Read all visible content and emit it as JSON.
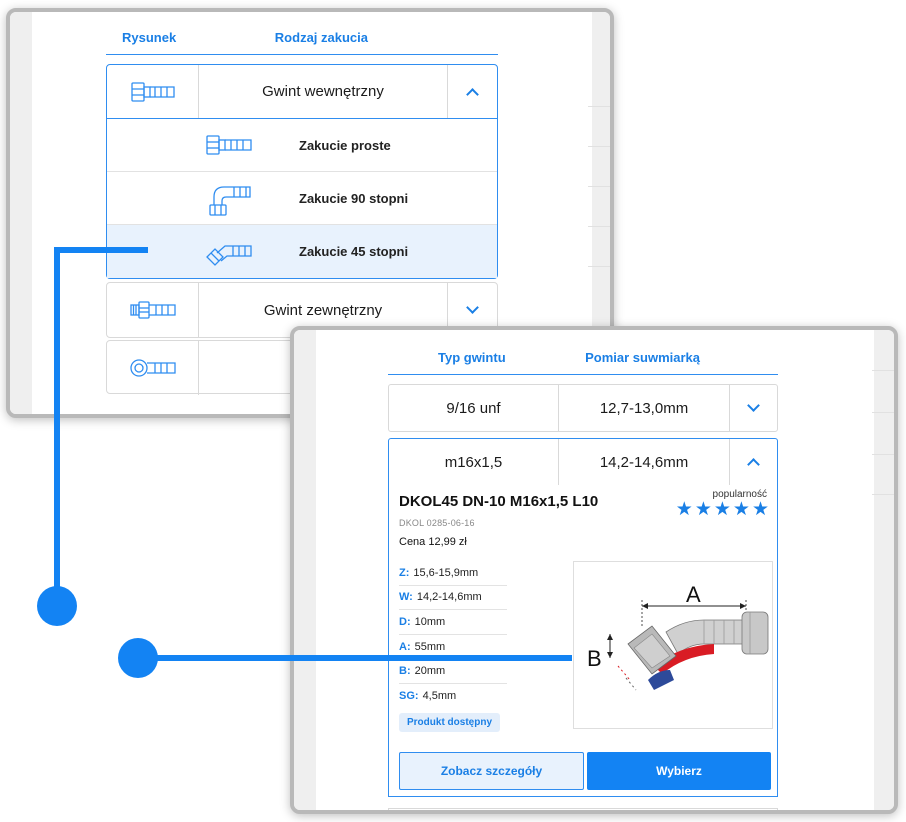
{
  "window1": {
    "tabs": [
      "Rysunek",
      "Rodzaj zakucia"
    ],
    "groups": [
      {
        "label": "Gwint wewnętrzny",
        "icon": "fitting-internal-thread-icon",
        "expanded": true,
        "items": [
          {
            "label": "Zakucie proste",
            "icon": "straight-fitting-icon"
          },
          {
            "label": "Zakucie 90 stopni",
            "icon": "elbow-90-fitting-icon"
          },
          {
            "label": "Zakucie 45 stopni",
            "icon": "elbow-45-fitting-icon",
            "selected": true
          }
        ]
      },
      {
        "label": "Gwint zewnętrzny",
        "icon": "fitting-external-thread-icon",
        "expanded": false
      },
      {
        "label": "",
        "icon": "banjo-fitting-icon",
        "expanded": false
      }
    ]
  },
  "window2": {
    "tabs": [
      "Typ gwintu",
      "Pomiar suwmiarką"
    ],
    "rows": [
      {
        "thread": "9/16 unf",
        "measure": "12,7-13,0mm",
        "expanded": false
      },
      {
        "thread": "m16x1,5",
        "measure": "14,2-14,6mm",
        "expanded": true
      }
    ],
    "product": {
      "title": "DKOL45 DN-10 M16x1,5 L10",
      "code": "DKOL 0285-06-16",
      "price": "Cena 12,99 zł",
      "popularity_label": "popularność",
      "rating": 5,
      "specs": [
        {
          "key": "Z:",
          "value": "15,6-15,9mm"
        },
        {
          "key": "W:",
          "value": "14,2-14,6mm"
        },
        {
          "key": "D:",
          "value": "10mm"
        },
        {
          "key": "A:",
          "value": "55mm"
        },
        {
          "key": "B:",
          "value": "20mm"
        },
        {
          "key": "SG:",
          "value": "4,5mm"
        }
      ],
      "availability": "Produkt dostępny",
      "drawing_labels": {
        "a": "A",
        "b": "B"
      },
      "details_button": "Zobacz szczegóły",
      "select_button": "Wybierz"
    }
  },
  "colors": {
    "accent": "#1383f3",
    "selected_bg": "#e8f2fd",
    "border": "#d9d9d9"
  }
}
